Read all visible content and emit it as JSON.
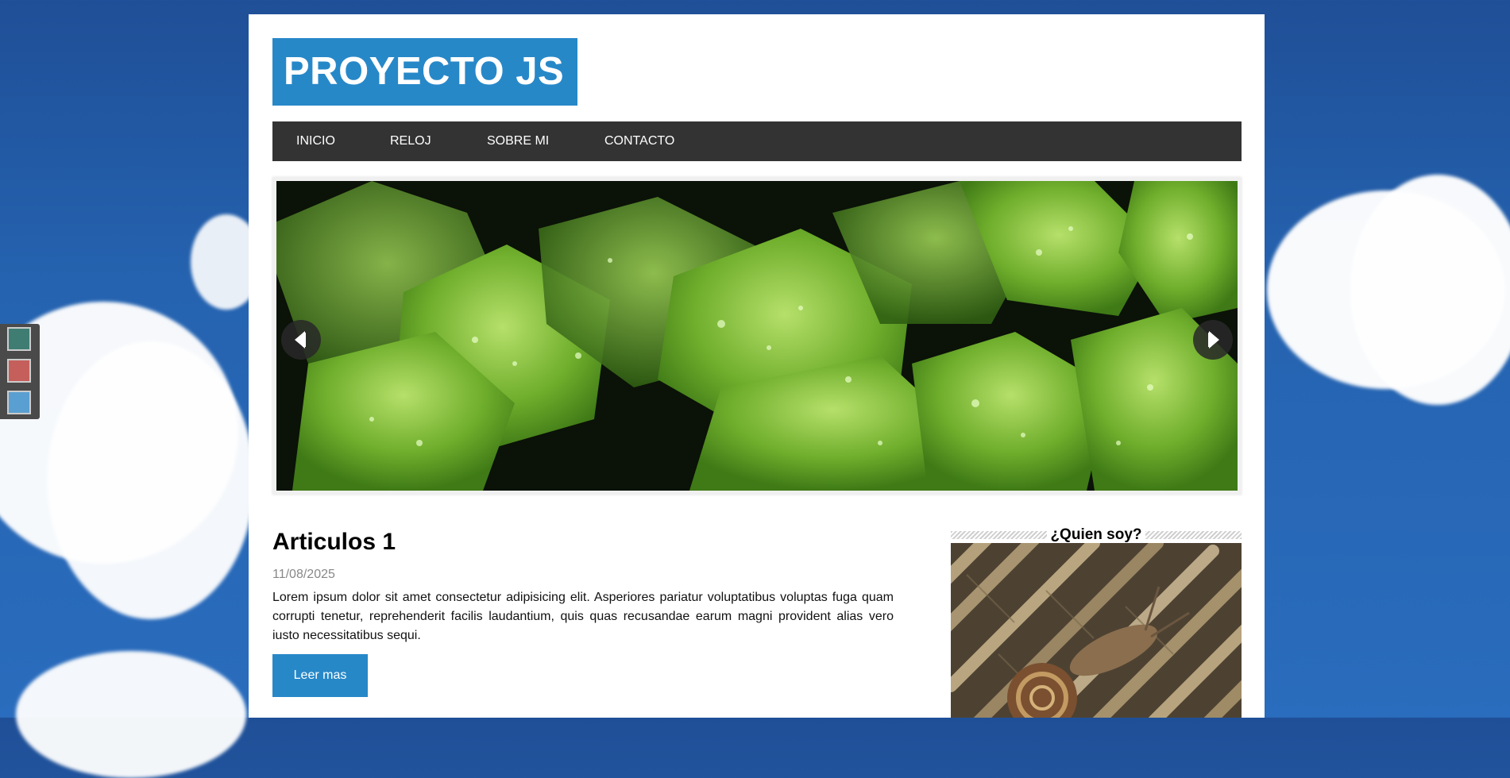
{
  "header": {
    "logo_text": "PROYECTO JS"
  },
  "nav": {
    "items": [
      {
        "label": "INICIO"
      },
      {
        "label": "RELOJ"
      },
      {
        "label": "SOBRE MI"
      },
      {
        "label": "CONTACTO"
      }
    ]
  },
  "theme_switcher": {
    "colors": [
      "#3f7d73",
      "#c45f5c",
      "#5a9fd1"
    ]
  },
  "slider": {
    "prev_icon": "chevron-left-icon",
    "next_icon": "chevron-right-icon"
  },
  "article": {
    "title": "Articulos 1",
    "date": "11/08/2025",
    "text": "Lorem ipsum dolor sit amet consectetur adipisicing elit. Asperiores pariatur voluptatibus voluptas fuga quam corrupti tenetur, reprehenderit facilis laudantium, quis quas recusandae earum magni provident alias vero iusto necessitatibus sequi.",
    "button_label": "Leer mas"
  },
  "aside": {
    "title": "¿Quien soy?"
  },
  "colors": {
    "accent": "#2788c8",
    "nav_bg": "#333333"
  }
}
